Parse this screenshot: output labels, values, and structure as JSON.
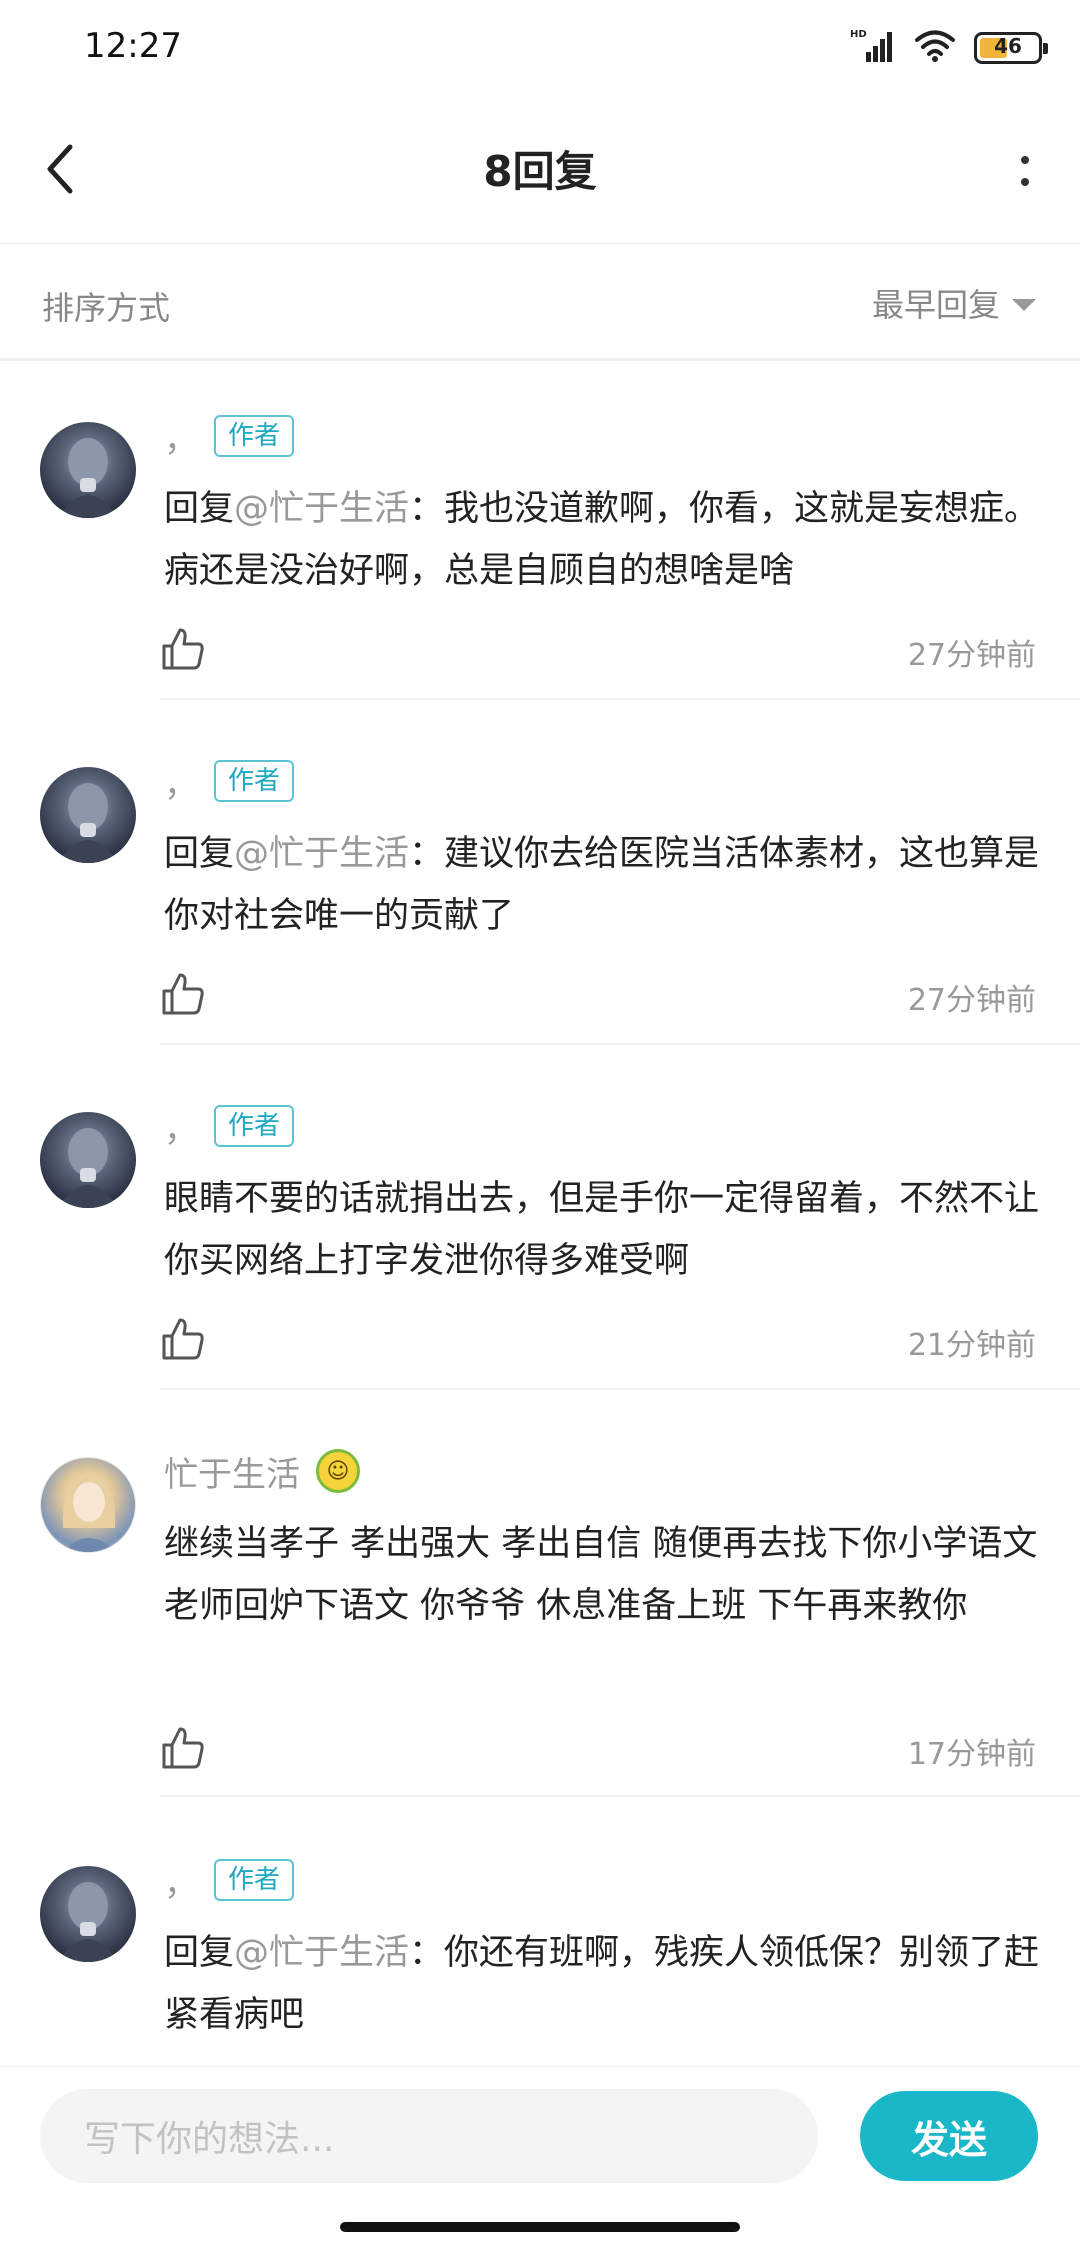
{
  "status_bar": {
    "time": "12:27",
    "network_label": "HD",
    "battery_level": "46"
  },
  "header": {
    "title": "8回复"
  },
  "sort": {
    "label": "排序方式",
    "selected": "最早回复"
  },
  "comments": [
    {
      "author": "，",
      "tag": "作者",
      "reply_prefix": "回复",
      "mention": "@忙于生活",
      "text": "：我也没道歉啊，你看，这就是妄想症。病还是没治好啊，总是自顾自的想啥是啥",
      "time": "27分钟前"
    },
    {
      "author": "，",
      "tag": "作者",
      "reply_prefix": "回复",
      "mention": "@忙于生活",
      "text": "：建议你去给医院当活体素材，这也算是你对社会唯一的贡献了",
      "time": "27分钟前"
    },
    {
      "author": "，",
      "tag": "作者",
      "text": "眼睛不要的话就捐出去，但是手你一定得留着，不然不让你买网络上打字发泄你得多难受啊",
      "time": "21分钟前"
    },
    {
      "author": "忙于生活",
      "text": "继续当孝子 孝出强大 孝出自信 随便再去找下你小学语文老师回炉下语文  你爷爷 休息准备上班 下午再来教你",
      "time": "17分钟前"
    },
    {
      "author": "，",
      "tag": "作者",
      "reply_prefix": "回复",
      "mention": "@忙于生活",
      "text": "：你还有班啊，残疾人领低保？别领了赶紧看病吧"
    }
  ],
  "input": {
    "placeholder": "写下你的想法...",
    "send_label": "发送"
  },
  "colors": {
    "accent": "#1ab7c9",
    "tag_border": "#5cc3d4",
    "muted_text": "#999999"
  },
  "icons": [
    "back-arrow-icon",
    "more-vertical-icon",
    "caret-down-icon",
    "thumbs-up-icon",
    "signal-icon",
    "wifi-icon",
    "battery-icon"
  ]
}
